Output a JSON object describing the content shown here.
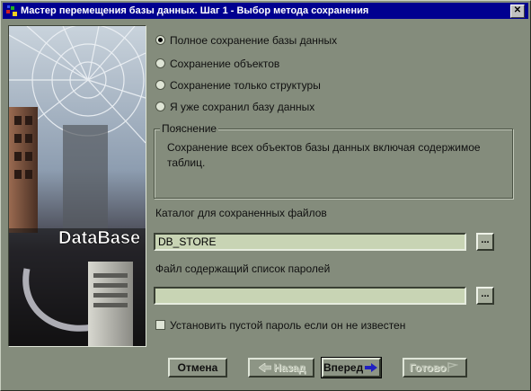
{
  "window": {
    "title": "Мастер перемещения базы данных. Шаг 1 - Выбор метода сохранения",
    "close_label": "✕"
  },
  "side_image": {
    "logo_text": "DataBase"
  },
  "options": [
    {
      "label": "Полное сохранение базы данных",
      "checked": true
    },
    {
      "label": "Сохранение объектов",
      "checked": false
    },
    {
      "label": "Сохранение только структуры",
      "checked": false
    },
    {
      "label": "Я уже сохранил базу данных",
      "checked": false
    }
  ],
  "explanation": {
    "legend": "Пояснение",
    "text": "Сохранение всех объектов базы данных включая содержимое таблиц."
  },
  "directory": {
    "label": "Каталог для сохраненных файлов",
    "value": "DB_STORE",
    "browse_label": "..."
  },
  "passwords_file": {
    "label": "Файл содержащий список паролей",
    "value": "",
    "browse_label": "..."
  },
  "empty_password": {
    "label": "Установить пустой пароль если он не известен",
    "checked": false
  },
  "buttons": {
    "cancel": "Отмена",
    "back": "Назад",
    "next": "Вперед",
    "finish": "Готово"
  },
  "colors": {
    "window_bg": "#848c7c",
    "titlebar": "#000090",
    "input_bg": "#c8d4b4",
    "next_arrow": "#2020c0"
  }
}
